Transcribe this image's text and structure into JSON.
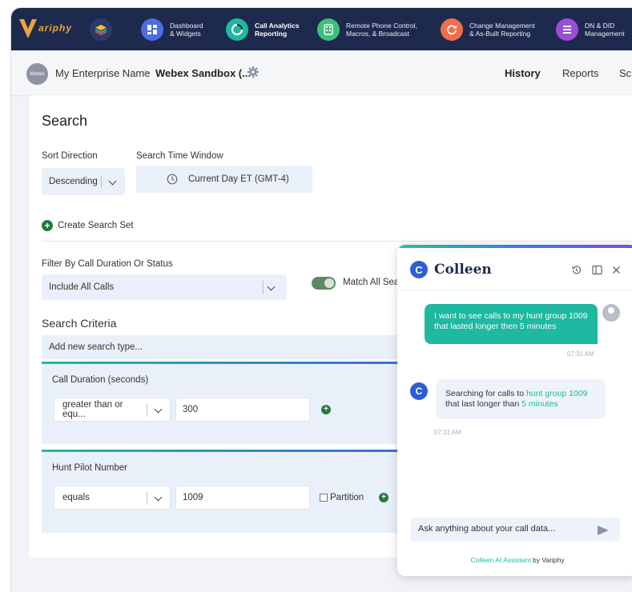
{
  "nav": {
    "logo_text": "ariphy",
    "items": [
      {
        "line1": "Dashboard",
        "line2": "& Widgets",
        "color": "#4c6de0",
        "active": false
      },
      {
        "line1": "Call Analytics",
        "line2": "Reporting",
        "color": "#1fb8a0",
        "active": true
      },
      {
        "line1": "Remote Phone Control,",
        "line2": "Macros, & Broadcast",
        "color": "#3dc07a",
        "active": false
      },
      {
        "line1": "Change Management",
        "line2": "& As-Built Reporting",
        "color": "#f06e4a",
        "active": false
      },
      {
        "line1": "DN & DID",
        "line2": "Management",
        "color": "#9b4dd6",
        "active": false
      }
    ]
  },
  "breadcrumb": {
    "avatar": "Webex",
    "enterprise": "My Enterprise Name",
    "separator": ">",
    "site": "Webex Sandbox (..."
  },
  "tabs": {
    "history": "History",
    "reports": "Reports",
    "sch": "Sch"
  },
  "search": {
    "title": "Search",
    "sort_label": "Sort Direction",
    "sort_value": "Descending",
    "time_label": "Search Time Window",
    "time_value": "Current Day ET (GMT-4)",
    "create_set": "Create Search Set",
    "filter_label": "Filter By Call Duration Or Status",
    "filter_value": "Include All Calls",
    "match_label": "Match All Sea",
    "criteria_title": "Search Criteria",
    "add_type_placeholder": "Add new search type...",
    "duration": {
      "title": "Call Duration (seconds)",
      "operator": "greater than or equ...",
      "value": "300"
    },
    "hunt": {
      "title": "Hunt Pilot Number",
      "operator": "equals",
      "value": "1009",
      "partition": "Partition"
    }
  },
  "chat": {
    "title": "Colleen",
    "user_message": "I want to see calls to my hunt group 1009 that lasted longer then 5 minutes",
    "user_time": "07:31 AM",
    "bot_prefix": "Searching for calls to ",
    "bot_hl1": "hunt group 1009",
    "bot_mid": " that last longer than ",
    "bot_hl2": "5 minutes",
    "bot_time": "07:31 AM",
    "input_placeholder": "Ask anything about your call data...",
    "footer_brand": "Colleen AI Assistant",
    "footer_by": " by Variphy"
  }
}
